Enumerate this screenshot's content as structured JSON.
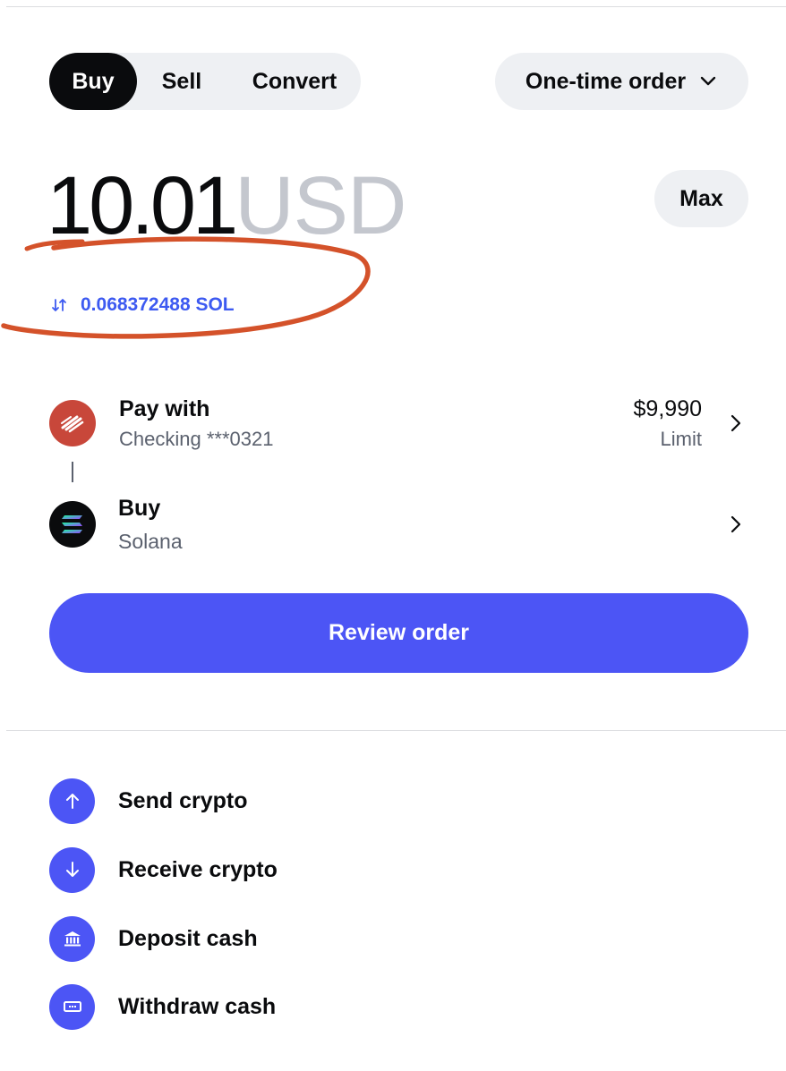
{
  "tabs": [
    {
      "label": "Buy",
      "active": true
    },
    {
      "label": "Sell",
      "active": false
    },
    {
      "label": "Convert",
      "active": false
    }
  ],
  "order_type": {
    "label": "One-time order",
    "icon": "chevron-down-icon"
  },
  "amount": {
    "value": "10.01",
    "currency": "USD"
  },
  "max_label": "Max",
  "conversion": {
    "text": "0.068372488 SOL",
    "icon": "swap-arrows-icon"
  },
  "pay_with": {
    "title": "Pay with",
    "account": "Checking ***0321",
    "limit_value": "$9,990",
    "limit_label": "Limit",
    "icon": "bank-logo-icon"
  },
  "buy_asset": {
    "title": "Buy",
    "asset": "Solana",
    "icon": "solana-logo-icon"
  },
  "review_button": "Review order",
  "actions": [
    {
      "label": "Send crypto",
      "icon": "arrow-up-icon"
    },
    {
      "label": "Receive crypto",
      "icon": "arrow-down-icon"
    },
    {
      "label": "Deposit cash",
      "icon": "bank-building-icon"
    },
    {
      "label": "Withdraw cash",
      "icon": "cash-icon"
    }
  ],
  "colors": {
    "accent": "#4c55f5",
    "link": "#3d5af1",
    "annotation": "#d4522a",
    "pill_bg": "#eef0f3",
    "text": "#0a0b0d",
    "muted": "#5b616e",
    "bank_red": "#c8473a"
  }
}
